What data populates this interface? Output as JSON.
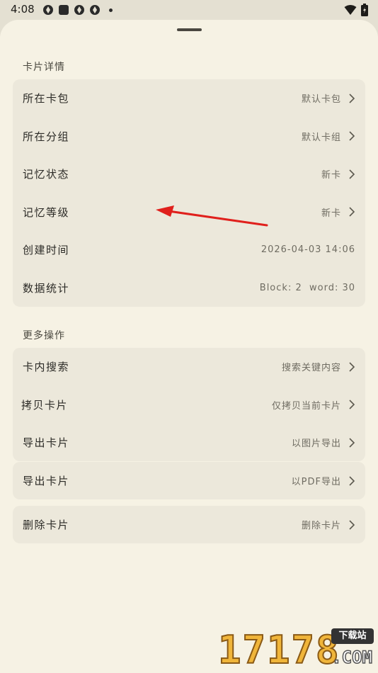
{
  "status_bar": {
    "time": "4:08",
    "left_icons": [
      "app-icon",
      "square-icon",
      "app-icon",
      "app-icon",
      "dot-icon"
    ],
    "right_icons": [
      "wifi-icon",
      "battery-icon"
    ]
  },
  "detail_section": {
    "title": "卡片详情",
    "rows": [
      {
        "label": "所在卡包",
        "value": "默认卡包",
        "chevron": true
      },
      {
        "label": "所在分组",
        "value": "默认卡组",
        "chevron": true
      },
      {
        "label": "记忆状态",
        "value": "新卡",
        "chevron": true
      },
      {
        "label": "记忆等级",
        "value": "新卡",
        "chevron": true
      },
      {
        "label": "创建时间",
        "value": "2026-04-03 14:06",
        "chevron": false
      },
      {
        "label": "数据统计",
        "value": "Block: 2  word: 30",
        "chevron": false
      }
    ]
  },
  "more_section": {
    "title": "更多操作",
    "rows": [
      {
        "label": "卡内搜索",
        "value": "搜索关键内容"
      },
      {
        "label": "拷贝卡片",
        "value": "仅拷贝当前卡片"
      },
      {
        "label": "导出卡片",
        "value": "以图片导出"
      }
    ]
  },
  "export_pdf": {
    "label": "导出卡片",
    "value": "以PDF导出"
  },
  "delete": {
    "label": "删除卡片",
    "value": "删除卡片"
  },
  "annotation": {
    "arrow_color": "#e0201c"
  },
  "watermark": {
    "digits": "17178",
    "tag": "下载站",
    "domain": ".COM"
  },
  "colors": {
    "sheet": "#f6f2e4",
    "card": "#ece8db",
    "backdrop": "#e4e0d2"
  }
}
